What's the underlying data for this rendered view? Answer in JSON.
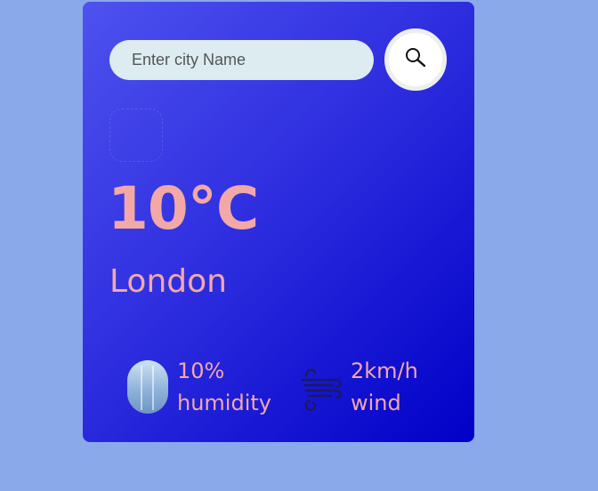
{
  "search": {
    "placeholder": "Enter city Name"
  },
  "icons": {
    "search": "search-icon",
    "weather": "weather-icon",
    "humidity": "humidity-icon",
    "wind": "wind-icon"
  },
  "weather": {
    "temperature": "10°C",
    "city": "London"
  },
  "details": {
    "humidity": {
      "value": "10%",
      "label": "humidity"
    },
    "wind": {
      "value": "2km/h",
      "label": "wind"
    }
  },
  "colors": {
    "background": "#8aa9eb",
    "card_gradient_start": "#4e52ee",
    "card_gradient_end": "#0000c8",
    "text_accent": "#f3a8a8",
    "input_bg": "#dcecf0"
  }
}
